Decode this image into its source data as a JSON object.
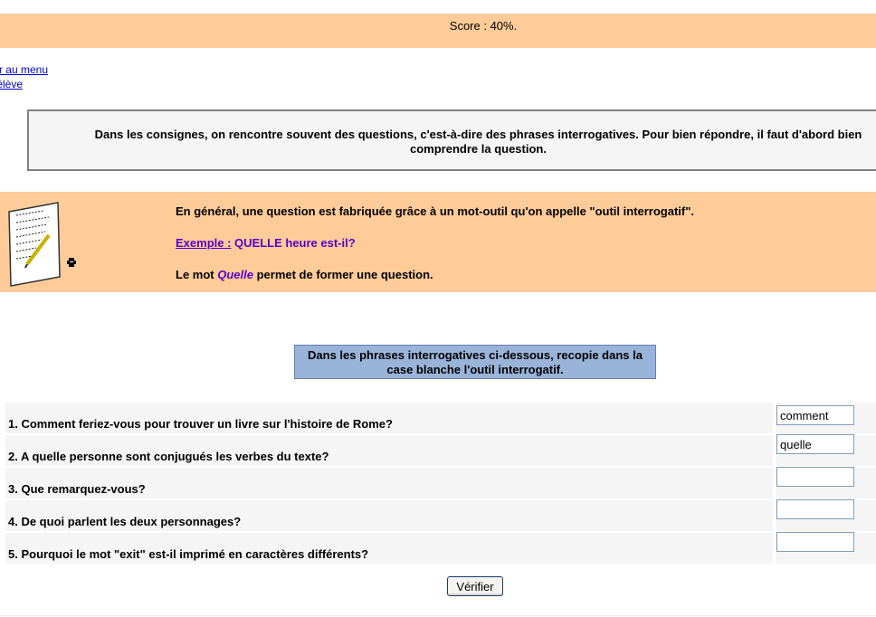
{
  "score": {
    "text": "Score : 40%."
  },
  "nav": {
    "menu_link": "Retour au menu",
    "student_link": "Espace élève"
  },
  "intro": {
    "text": "Dans les consignes, on rencontre souvent des questions, c'est-à-dire des phrases interrogatives. Pour bien répondre, il faut d'abord bien comprendre la question."
  },
  "lesson": {
    "line1": "En général, une question est fabriquée grâce à un mot-outil qu'on appelle \"outil interrogatif\".",
    "example_label": "Exemple :",
    "example_text": " QUELLE heure est-il?",
    "line3_before": "Le mot ",
    "line3_word": "Quelle",
    "line3_after": " permet de former une question."
  },
  "instruction": {
    "text": "Dans les phrases interrogatives ci-dessous, recopie dans la case blanche l'outil interrogatif."
  },
  "questions": [
    {
      "text": "1. Comment feriez-vous pour trouver un livre sur l'histoire de Rome?",
      "answer": "comment"
    },
    {
      "text": "2. A quelle personne sont conjugués les verbes du texte?",
      "answer": "quelle"
    },
    {
      "text": "3. Que remarquez-vous?",
      "answer": ""
    },
    {
      "text": "4. De quoi parlent les deux personnages?",
      "answer": ""
    },
    {
      "text": "5. Pourquoi le mot \"exit\" est-il imprimé en caractères différents?",
      "answer": ""
    }
  ],
  "verify_button": "Vérifier",
  "colors": {
    "accent_orange": "#ffcc99",
    "instruction_blue": "#99b3d9",
    "link_purple": "#5500cc"
  },
  "icons": [
    "paper-document-icon",
    "printer-icon"
  ]
}
